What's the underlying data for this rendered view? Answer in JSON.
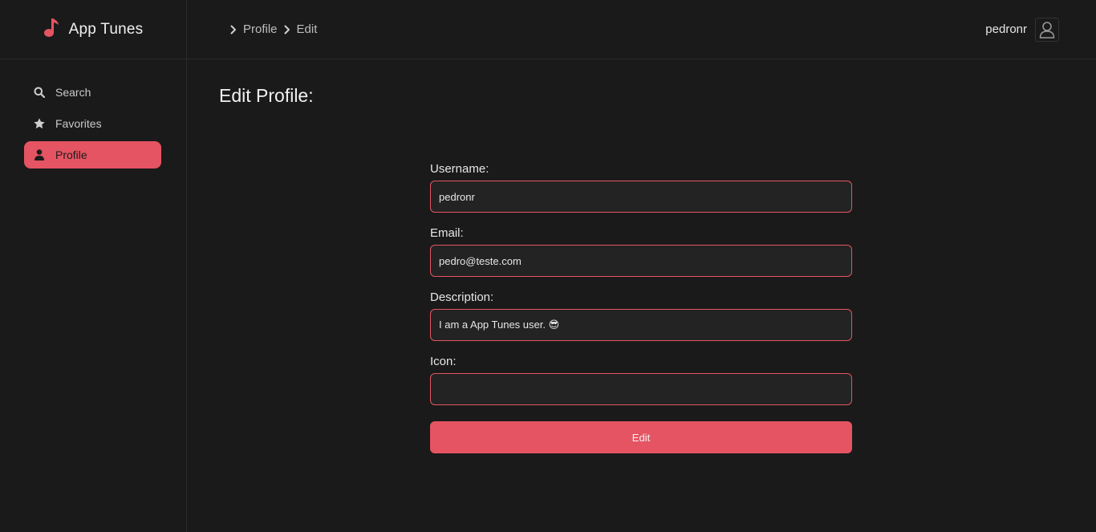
{
  "app": {
    "title": "App Tunes",
    "accent_color": "#e55462"
  },
  "sidebar": {
    "items": [
      {
        "label": "Search",
        "icon": "search-icon",
        "active": false
      },
      {
        "label": "Favorites",
        "icon": "star-icon",
        "active": false
      },
      {
        "label": "Profile",
        "icon": "user-icon",
        "active": true
      }
    ]
  },
  "header": {
    "breadcrumb": [
      "Profile",
      "Edit"
    ],
    "username": "pedronr",
    "avatar_icon": "user-outline-icon"
  },
  "main": {
    "title": "Edit Profile:",
    "form": {
      "username": {
        "label": "Username:",
        "value": "pedronr"
      },
      "email": {
        "label": "Email:",
        "value": "pedro@teste.com"
      },
      "description": {
        "label": "Description:",
        "value": "I am a App Tunes user. 😎"
      },
      "icon": {
        "label": "Icon:",
        "value": ""
      },
      "submit_label": "Edit"
    }
  }
}
